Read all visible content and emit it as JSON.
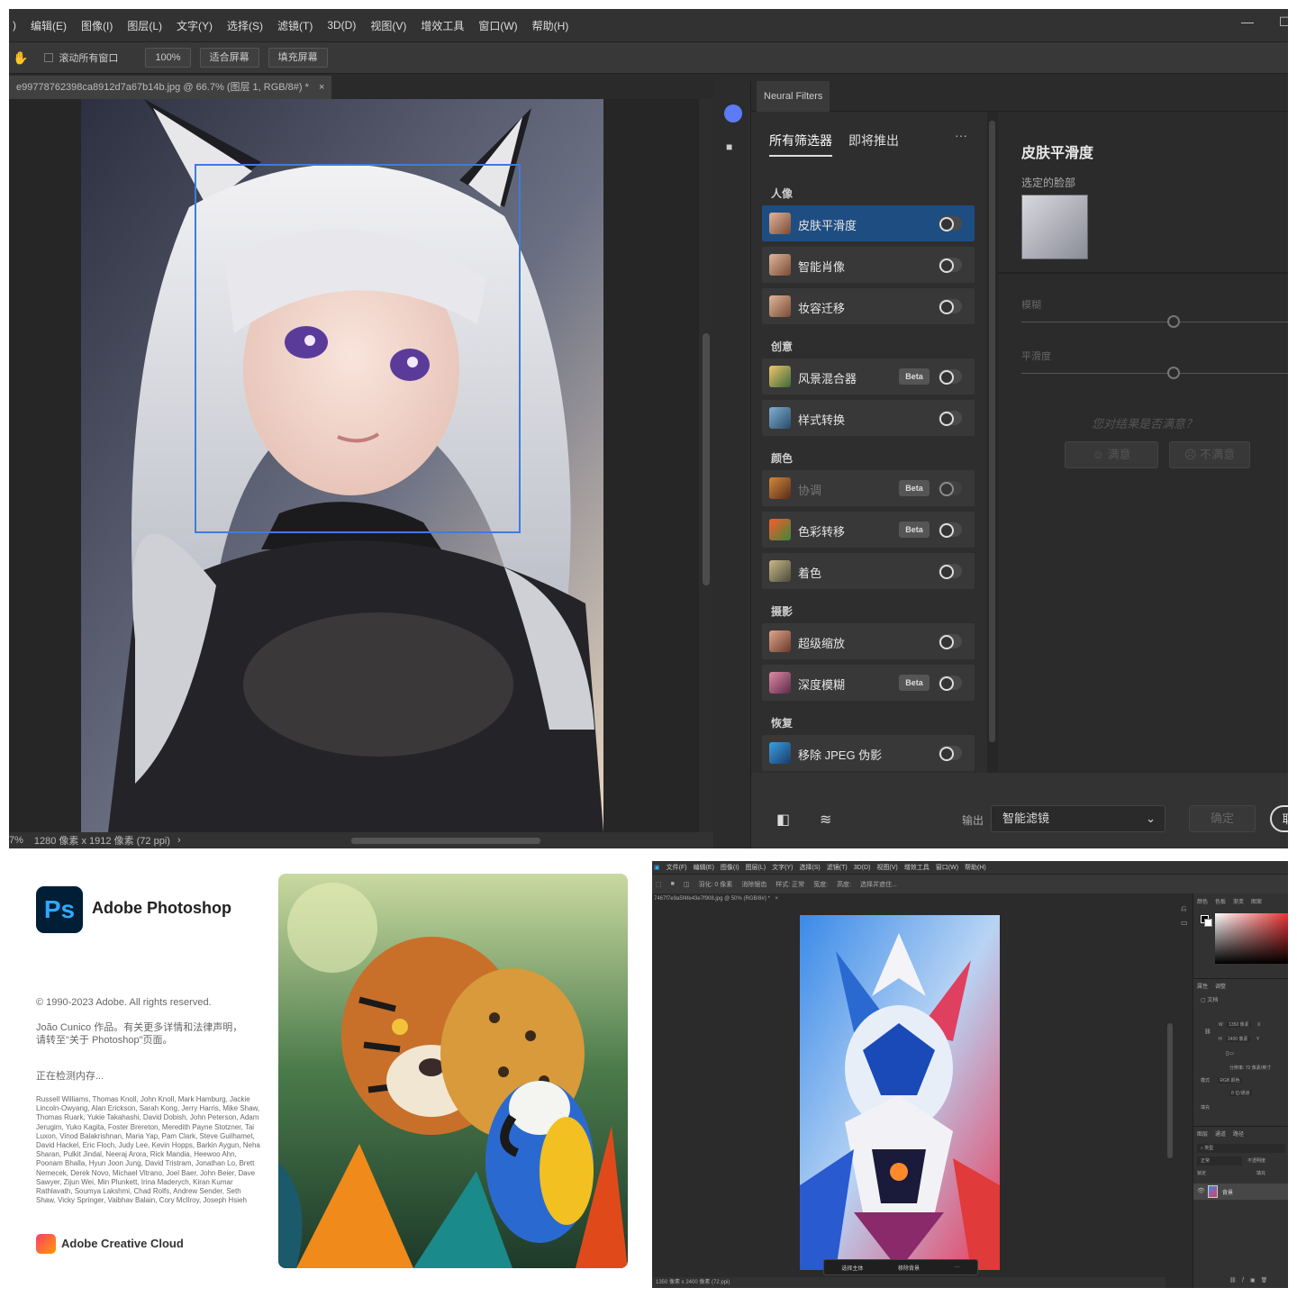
{
  "top": {
    "menu": [
      ")",
      "编辑(E)",
      "图像(I)",
      "图层(L)",
      "文字(Y)",
      "选择(S)",
      "滤镜(T)",
      "3D(D)",
      "视图(V)",
      "增效工具",
      "窗口(W)",
      "帮助(H)"
    ],
    "options": {
      "scroll_all": "滚动所有窗口",
      "zoom": "100%",
      "fit_screen": "适合屏幕",
      "fill_screen": "填充屏幕"
    },
    "doc_tab": "e99778762398ca8912d7a67b14b.jpg @ 66.7% (图层 1, RGB/8#) *",
    "status": {
      "zoom": "7%",
      "size": "1280 像素 x 1912 像素 (72 ppi)"
    },
    "neural": {
      "title": "Neural Filters",
      "tabs": {
        "all": "所有筛选器",
        "upcoming": "即将推出"
      },
      "categories": {
        "portrait": "人像",
        "creative": "创意",
        "color": "颜色",
        "photo": "摄影",
        "restore": "恢复"
      },
      "filters": [
        {
          "label": "皮肤平滑度"
        },
        {
          "label": "智能肖像"
        },
        {
          "label": "妆容迁移"
        },
        {
          "label": "风景混合器",
          "badge": "Beta"
        },
        {
          "label": "样式转换"
        },
        {
          "label": "协调",
          "badge": "Beta"
        },
        {
          "label": "色彩转移",
          "badge": "Beta"
        },
        {
          "label": "着色"
        },
        {
          "label": "超级缩放"
        },
        {
          "label": "深度模糊",
          "badge": "Beta"
        },
        {
          "label": "移除 JPEG 伪影"
        }
      ],
      "settings": {
        "title": "皮肤平滑度",
        "face_label": "选定的脸部",
        "blur": "模糊",
        "smooth": "平滑度",
        "question": "您对结果是否满意？",
        "yes": "满意",
        "no": "不满意"
      },
      "footer": {
        "output_label": "输出",
        "output_value": "智能滤镜",
        "ok": "确定",
        "cancel": "取"
      }
    }
  },
  "splash": {
    "logo": "Ps",
    "name": "Adobe Photoshop",
    "copyright": "© 1990-2023 Adobe. All rights reserved.",
    "artwork_note": "João Cunico 作品。有关更多详情和法律声明，请转至\"关于 Photoshop\"页面。",
    "loading": "正在检测内存...",
    "credits": "Russell Williams, Thomas Knoll, John Knoll, Mark Hamburg, Jackie Lincoln-Owyang, Alan Erickson, Sarah Kong, Jerry Harris, Mike Shaw, Thomas Ruark, Yukie Takahashi, David Dobish, John Peterson, Adam Jerugim, Yuko Kagita, Foster Brereton, Meredith Payne Stotzner, Tai Luxon, Vinod Balakrishnan, Maria Yap, Pam Clark, Steve Guilhamet, David Hackel, Eric Floch, Judy Lee, Kevin Hopps, Barkin Aygun, Neha Sharan, Pulkit Jindal, Neeraj Arora, Rick Mandia, Heewoo Ahn, Poonam Bhalla, Hyun Joon Jung, David Tristram, Jonathan Lo, Brett Nemecek, Derek Novo, Michael Vitrano, Joel Baer, John Beier, Dave Sawyer, Zijun Wei, Min Plunkett, Irina Maderych, Kiran Kumar Rathlavath, Soumya Lakshmi, Chad Rolfs, Andrew Sender, Seth Shaw, Vicky Springer, Vaibhav Balain, Cory McIlroy, Joseph Hsieh",
    "brand": "Adobe Creative Cloud"
  },
  "bottom_right": {
    "menu": [
      "文件(F)",
      "编辑(E)",
      "图像(I)",
      "图层(L)",
      "文字(Y)",
      "选择(S)",
      "滤镜(T)",
      "3D(D)",
      "视图(V)",
      "增效工具",
      "窗口(W)",
      "帮助(H)"
    ],
    "options": [
      "羽化: 0 像素",
      "消除锯齿",
      "样式: 正常",
      "宽度:",
      "高度:",
      "选择并遮住..."
    ],
    "doc_tab": "7467f7e9a5f4fe43e7f908.jpg @ 50% (RGB/8#) *",
    "status": "1350 像素 x 2400 像素 (72 ppi)",
    "ctx": {
      "select_subject": "选择主体",
      "remove_bg": "移除背景"
    },
    "panel_tabs": [
      "颜色",
      "色板",
      "渐变",
      "图案"
    ],
    "prop_tabs": [
      "属性",
      "调整"
    ],
    "doc_label": "文档",
    "w_label": "W",
    "w_val": "1350 像素",
    "h_label": "H",
    "h_val": "2400 像素",
    "x_label": "X",
    "y_label": "Y",
    "resolution": "分辨率: 72 像素/英寸",
    "mode_label": "模式",
    "mode_val": "RGB 颜色",
    "bits_val": "8 位/通道",
    "fill_label": "填充",
    "layer_tabs": [
      "图层",
      "通道",
      "路径"
    ],
    "search": "类型",
    "blend": "正常",
    "opacity": "不透明度",
    "lock": "锁定",
    "fill2": "填充",
    "layer_name": "背景"
  }
}
